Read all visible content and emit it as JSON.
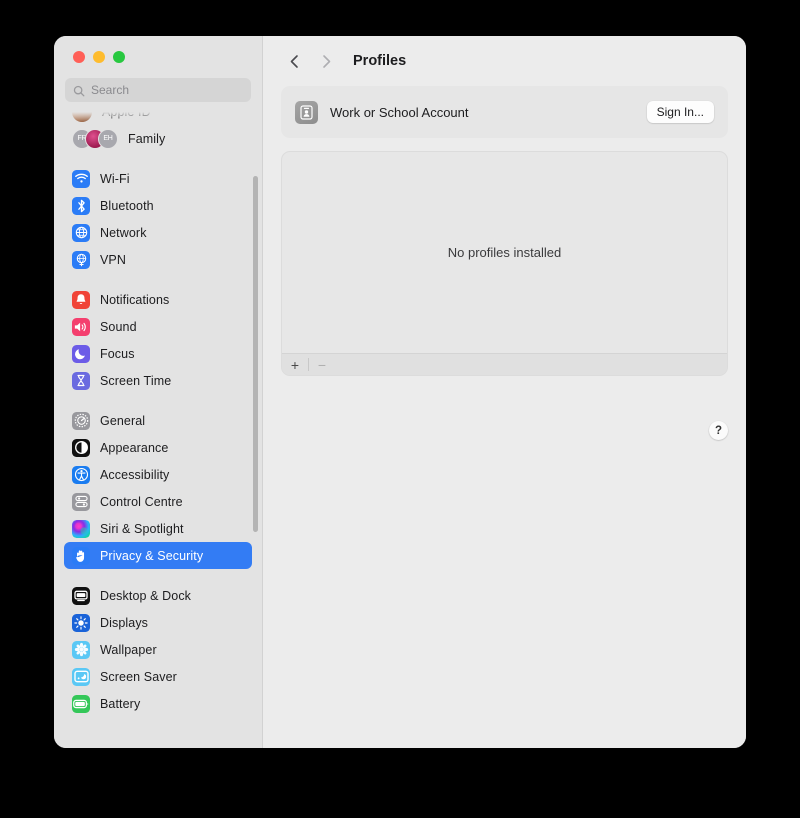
{
  "window": {
    "traffic_lights": [
      {
        "name": "close",
        "color": "#ff5f57"
      },
      {
        "name": "minimize",
        "color": "#febc2e"
      },
      {
        "name": "zoom",
        "color": "#28c840"
      }
    ]
  },
  "sidebar": {
    "search": {
      "placeholder": "Search",
      "value": "",
      "icon": "search-icon"
    },
    "groups": [
      {
        "items": [
          {
            "label": "Apple ID",
            "icon": "user-photo-avatar"
          },
          {
            "label": "Family",
            "icon": "family-avatars",
            "avatars": [
              "FR",
              "",
              "EH"
            ]
          }
        ]
      },
      {
        "items": [
          {
            "label": "Wi-Fi",
            "icon": "wifi-icon",
            "color": "#2b7cf6"
          },
          {
            "label": "Bluetooth",
            "icon": "bluetooth-icon",
            "color": "#2b7cf6"
          },
          {
            "label": "Network",
            "icon": "globe-icon",
            "color": "#2b7cf6"
          },
          {
            "label": "VPN",
            "icon": "vpn-globe-icon",
            "color": "#2b7cf6"
          }
        ]
      },
      {
        "items": [
          {
            "label": "Notifications",
            "icon": "bell-icon",
            "color": "#f04438"
          },
          {
            "label": "Sound",
            "icon": "speaker-icon",
            "color": "#f43f6e"
          },
          {
            "label": "Focus",
            "icon": "moon-icon",
            "color": "#6c5ce7"
          },
          {
            "label": "Screen Time",
            "icon": "hourglass-icon",
            "color": "#6a6ae0"
          }
        ]
      },
      {
        "items": [
          {
            "label": "General",
            "icon": "gear-icon",
            "color": "#98989d"
          },
          {
            "label": "Appearance",
            "icon": "contrast-circle-icon",
            "color": "#111111"
          },
          {
            "label": "Accessibility",
            "icon": "accessibility-icon",
            "color": "#1a7cf0"
          },
          {
            "label": "Control Centre",
            "icon": "control-centre-icon",
            "color": "#98989d"
          },
          {
            "label": "Siri & Spotlight",
            "icon": "siri-orb-icon",
            "color": "#6e2bd9"
          },
          {
            "label": "Privacy & Security",
            "icon": "hand-raised-icon",
            "color": "#2b7cf6",
            "selected": true
          }
        ]
      },
      {
        "items": [
          {
            "label": "Desktop & Dock",
            "icon": "desktop-dock-icon",
            "color": "#111111"
          },
          {
            "label": "Displays",
            "icon": "brightness-icon",
            "color": "#1a63d8"
          },
          {
            "label": "Wallpaper",
            "icon": "wallpaper-flower-icon",
            "color": "#5ac8f5"
          },
          {
            "label": "Screen Saver",
            "icon": "screen-saver-icon",
            "color": "#5ac8f5"
          },
          {
            "label": "Battery",
            "icon": "battery-icon",
            "color": "#34c759"
          }
        ]
      }
    ],
    "selected_color": "#337cf4"
  },
  "main": {
    "nav": {
      "back_icon": "chevron-left-icon",
      "forward_icon": "chevron-right-icon"
    },
    "title": "Profiles",
    "account": {
      "icon": "id-badge-icon",
      "name": "Work or School Account",
      "button": "Sign In..."
    },
    "profiles_list": {
      "empty_text": "No profiles installed",
      "add_label": "+",
      "remove_label": "−"
    },
    "help": {
      "label": "?",
      "icon": "help-icon"
    }
  }
}
